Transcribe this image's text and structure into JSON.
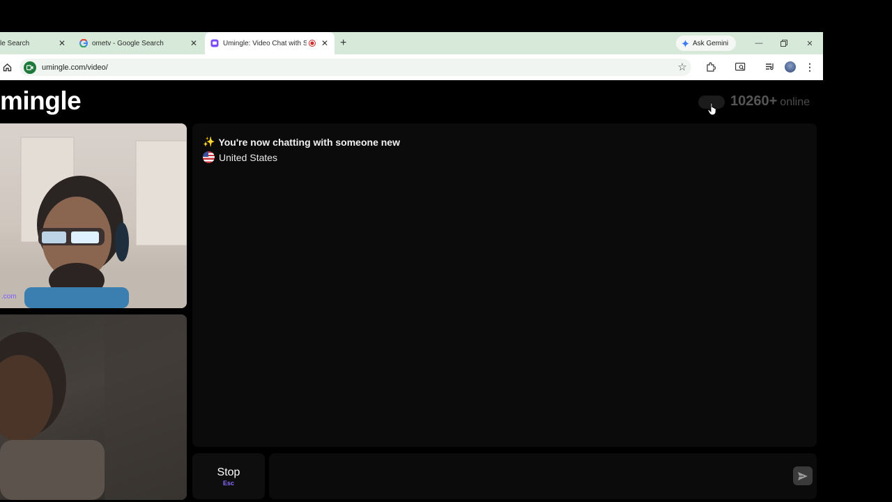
{
  "browser": {
    "tabs": [
      {
        "title": "le Search",
        "favicon": "google-icon"
      },
      {
        "title": "ometv - Google Search",
        "favicon": "google-icon"
      },
      {
        "title": "Umingle: Video Chat with S",
        "favicon": "umingle-icon",
        "active": true,
        "recording": true
      }
    ],
    "new_tab": "+",
    "gemini_label": "Ask Gemini",
    "url": "umingle.com/video/"
  },
  "page": {
    "logo": "mingle",
    "online_count": "10260+",
    "online_label": "online",
    "webcam_watermark": ".com"
  },
  "chat": {
    "status_emoji": "✨",
    "status_text": "You're now chatting with someone new",
    "country": "United States"
  },
  "controls": {
    "stop_label": "Stop",
    "stop_shortcut": "Esc"
  },
  "colors": {
    "tabbar": "#d7ead9",
    "accent": "#8a6bff",
    "background": "#000000"
  }
}
